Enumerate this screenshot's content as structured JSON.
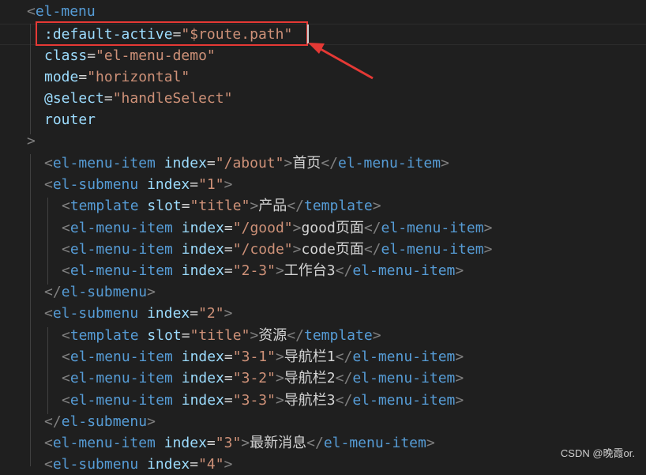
{
  "colors": {
    "background": "#1f1f1f",
    "tag": "#569cd6",
    "attribute": "#9cdcfe",
    "string": "#ce9178",
    "text": "#d4d4d4",
    "bracket": "#808080",
    "annotation": "#e53935"
  },
  "code": {
    "l1": {
      "tag": "el-menu"
    },
    "l2": {
      "attr": ":default-active",
      "value": "\"$route.path\""
    },
    "l3": {
      "attr": "class",
      "value": "\"el-menu-demo\""
    },
    "l4": {
      "attr": "mode",
      "value": "\"horizontal\""
    },
    "l5": {
      "attr": "@select",
      "value": "\"handleSelect\""
    },
    "l6": {
      "attr": "router"
    },
    "l8": {
      "tag": "el-menu-item",
      "attr": "index",
      "value": "\"/about\"",
      "text": "首页",
      "close": "el-menu-item"
    },
    "l9": {
      "tag": "el-submenu",
      "attr": "index",
      "value": "\"1\""
    },
    "l10": {
      "tag": "template",
      "attr": "slot",
      "value": "\"title\"",
      "text": "产品",
      "close": "template"
    },
    "l11": {
      "tag": "el-menu-item",
      "attr": "index",
      "value": "\"/good\"",
      "text": "good页面",
      "close": "el-menu-item"
    },
    "l12": {
      "tag": "el-menu-item",
      "attr": "index",
      "value": "\"/code\"",
      "text": "code页面",
      "close": "el-menu-item"
    },
    "l13": {
      "tag": "el-menu-item",
      "attr": "index",
      "value": "\"2-3\"",
      "text": "工作台3",
      "close": "el-menu-item"
    },
    "l14": {
      "close": "el-submenu"
    },
    "l15": {
      "tag": "el-submenu",
      "attr": "index",
      "value": "\"2\""
    },
    "l16": {
      "tag": "template",
      "attr": "slot",
      "value": "\"title\"",
      "text": "资源",
      "close": "template"
    },
    "l17": {
      "tag": "el-menu-item",
      "attr": "index",
      "value": "\"3-1\"",
      "text": "导航栏1",
      "close": "el-menu-item"
    },
    "l18": {
      "tag": "el-menu-item",
      "attr": "index",
      "value": "\"3-2\"",
      "text": "导航栏2",
      "close": "el-menu-item"
    },
    "l19": {
      "tag": "el-menu-item",
      "attr": "index",
      "value": "\"3-3\"",
      "text": "导航栏3",
      "close": "el-menu-item"
    },
    "l20": {
      "close": "el-submenu"
    },
    "l21": {
      "tag": "el-menu-item",
      "attr": "index",
      "value": "\"3\"",
      "text": "最新消息",
      "close": "el-menu-item"
    },
    "l22": {
      "tag": "el-submenu",
      "attr": "index",
      "value": "\"4\""
    }
  },
  "watermark": "CSDN @晚霞or."
}
